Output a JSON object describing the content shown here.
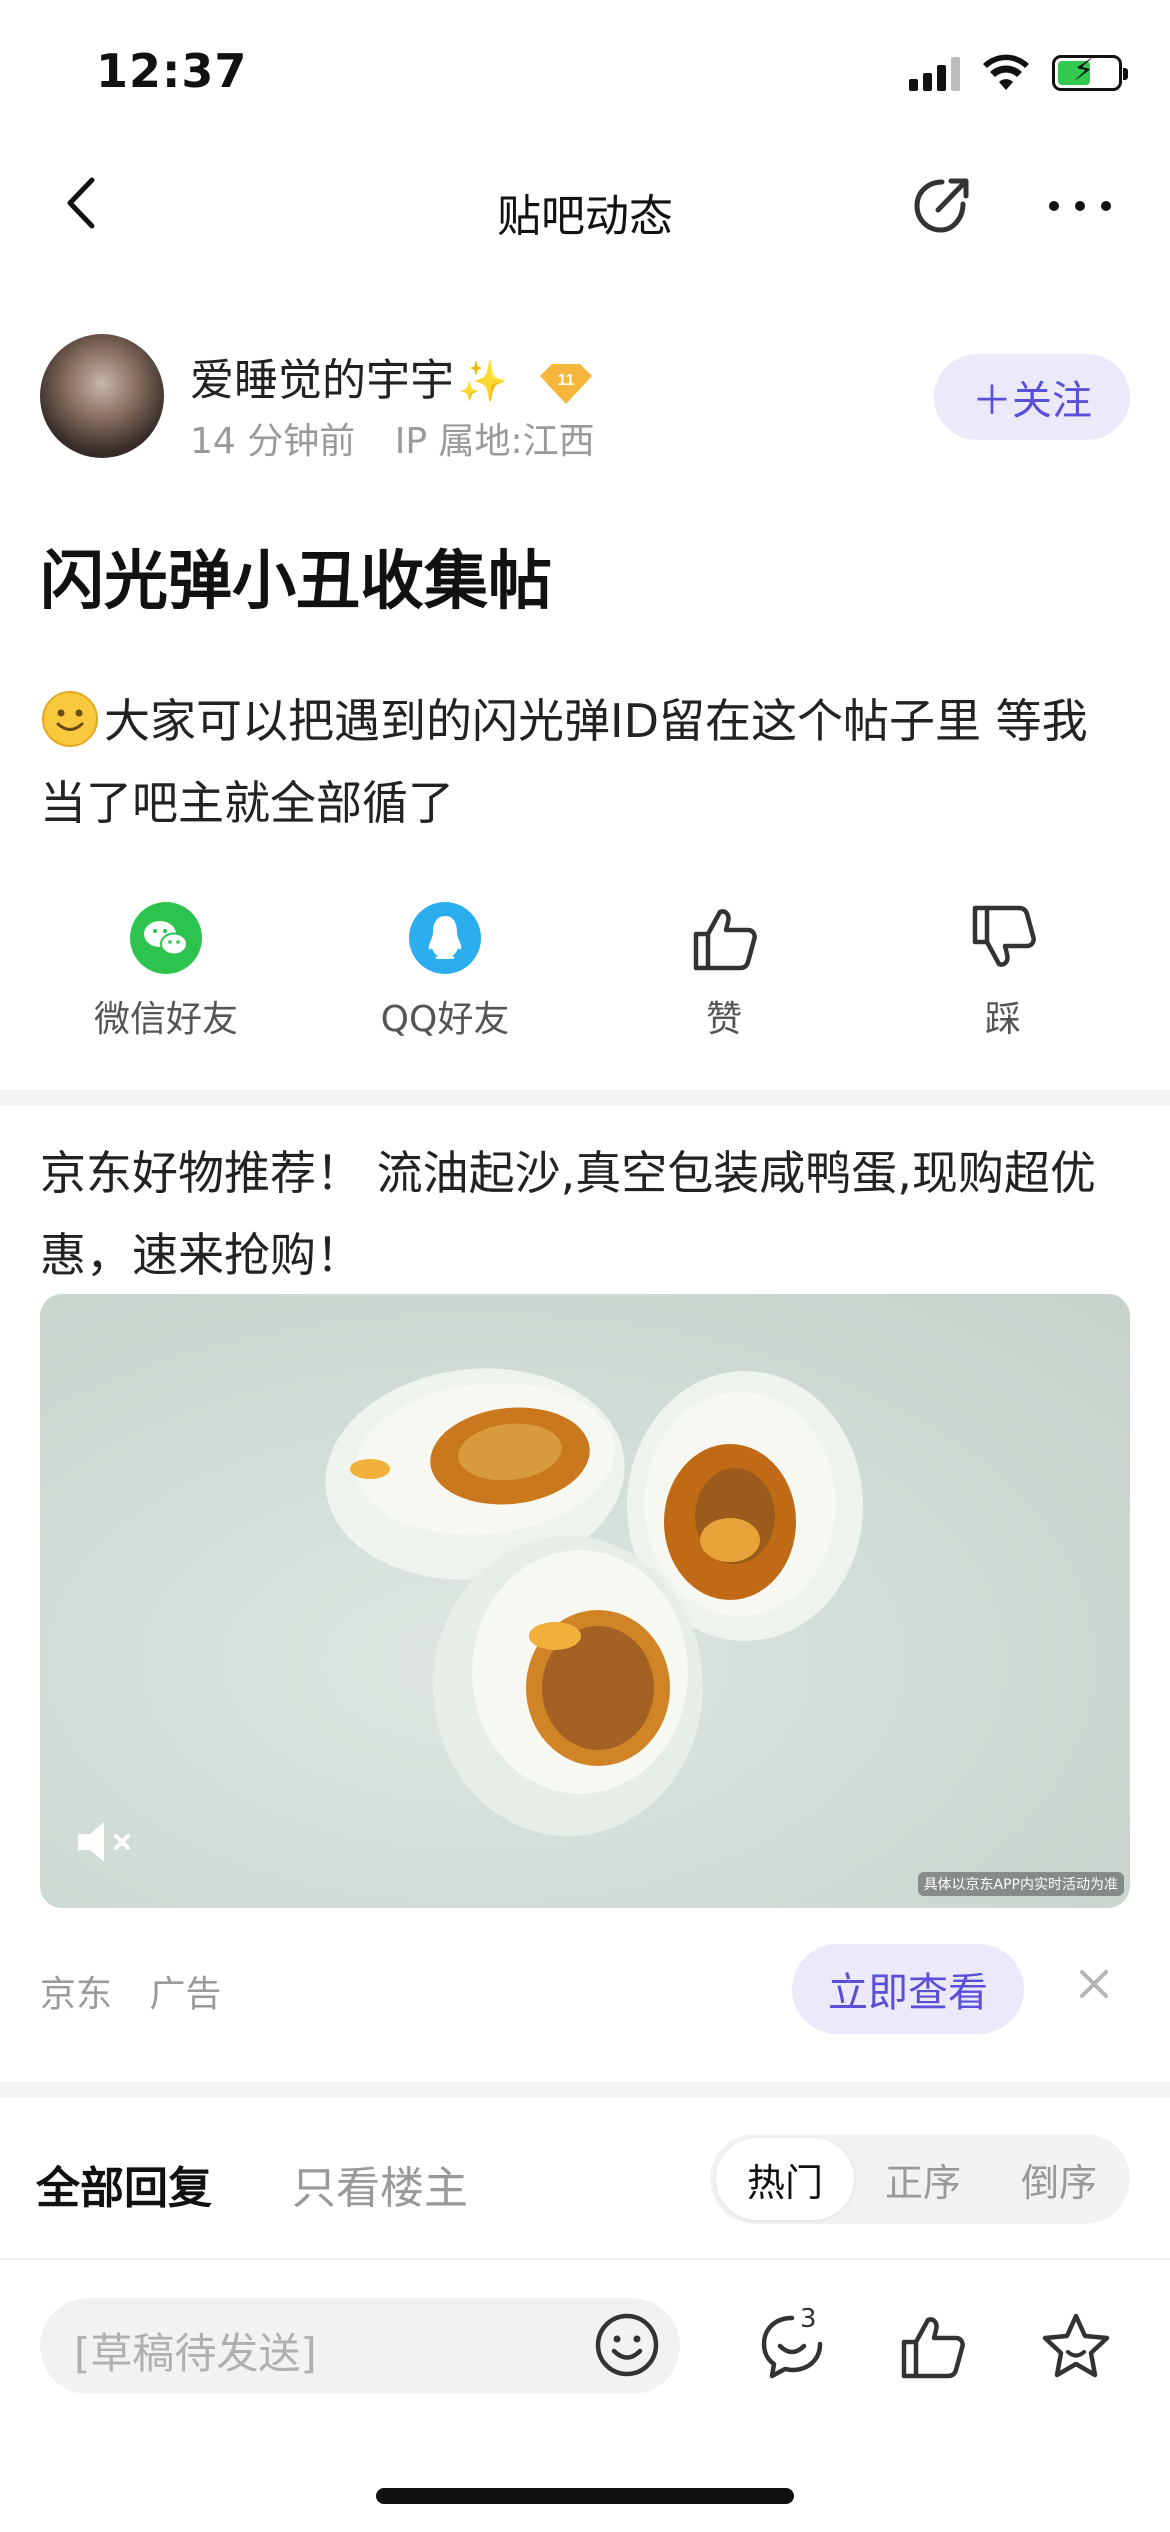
{
  "status_bar": {
    "time": "12:37"
  },
  "nav": {
    "title": "贴吧动态"
  },
  "author": {
    "name": "爱睡觉的宇宇",
    "name_emoji": "✨",
    "level": "11",
    "time_ago": "14 分钟前",
    "ip_location": "IP 属地:江西",
    "follow_label": "＋关注"
  },
  "post": {
    "title": "闪光弹小丑收集帖",
    "content": "大家可以把遇到的闪光弹ID留在这个帖子里 等我当了吧主就全部循了"
  },
  "actions": [
    {
      "label": "微信好友",
      "icon": "wechat-icon"
    },
    {
      "label": "QQ好友",
      "icon": "qq-icon"
    },
    {
      "label": "赞",
      "icon": "thumbs-up-icon"
    },
    {
      "label": "踩",
      "icon": "thumbs-down-icon"
    }
  ],
  "ad": {
    "text": "京东好物推荐！ 流油起沙,真空包装咸鸭蛋,现购超优惠，速来抢购！",
    "disclaimer": "具体以京东APP内实时活动为准",
    "source": "京东",
    "tag": "广告",
    "cta": "立即查看"
  },
  "replies": {
    "tab_all": "全部回复",
    "tab_owner": "只看楼主",
    "sort_options": [
      "热门",
      "正序",
      "倒序"
    ],
    "active_sort": "热门"
  },
  "bottom_bar": {
    "draft_placeholder": "[草稿待发送]",
    "comment_count": "3"
  },
  "colors": {
    "accent": "#5a4fd9",
    "accent_bg": "#ece9fb",
    "wechat": "#2dc34f",
    "qq": "#2aaeee"
  }
}
